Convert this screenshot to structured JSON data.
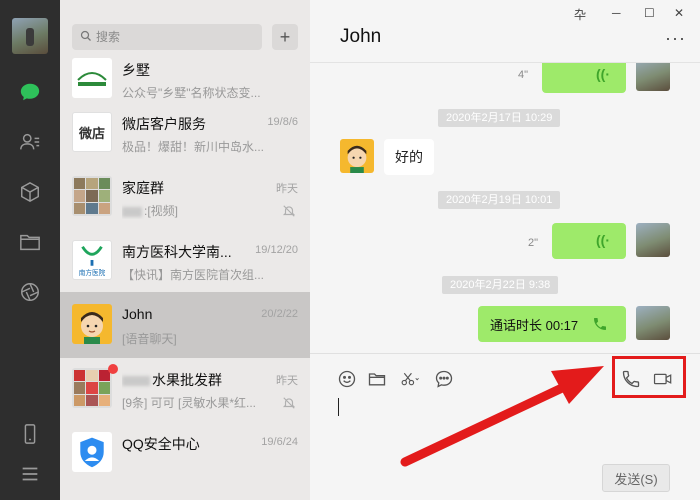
{
  "sidebar": {
    "icons": [
      "chat-icon",
      "contacts-icon",
      "favorites-icon",
      "folder-icon",
      "moments-icon",
      "phone-icon",
      "menu-icon"
    ]
  },
  "search": {
    "placeholder": "搜索",
    "add_label": "+"
  },
  "chats": [
    {
      "name": "乡墅",
      "time": "",
      "preview": "公众号\"乡墅\"名称状态变..."
    },
    {
      "name": "微店客户服务",
      "time": "19/8/6",
      "preview": "极品！爆甜！新川中岛水..."
    },
    {
      "name": "家庭群",
      "time": "昨天",
      "preview": ":[视频]",
      "muted": true
    },
    {
      "name": "南方医科大学南...",
      "time": "19/12/20",
      "preview": "【快讯】南方医院首次组..."
    },
    {
      "name": "John",
      "time": "20/2/22",
      "preview": "[语音聊天]"
    },
    {
      "name": "水果批发群",
      "time": "昨天",
      "preview": "[9条] 可可 [灵敏水果*红...",
      "muted": true
    },
    {
      "name": "QQ安全中心",
      "time": "19/6/24",
      "preview": ""
    }
  ],
  "chat_logos": {
    "weidian": "微店",
    "nanfang": "南方医院"
  },
  "conversation": {
    "title": "John",
    "window_controls": [
      "卆",
      "─",
      "☐",
      "✕"
    ],
    "more": "···",
    "messages": [
      {
        "type": "voice-out",
        "duration": "4\""
      },
      {
        "type": "timestamp",
        "text": "2020年2月17日 10:29"
      },
      {
        "type": "text-in",
        "text": "好的"
      },
      {
        "type": "timestamp",
        "text": "2020年2月19日 10:01"
      },
      {
        "type": "voice-out",
        "duration": "2\""
      },
      {
        "type": "timestamp",
        "text": "2020年2月22日 9:38"
      },
      {
        "type": "call-out",
        "text": "通话时长 00:17"
      }
    ]
  },
  "composer": {
    "tools": [
      "emoji-icon",
      "folder-icon",
      "scissors-icon",
      "chat-history-icon",
      "voice-call-icon",
      "video-call-icon"
    ],
    "send_label": "发送(S)"
  },
  "colors": {
    "accent_green": "#9eea6a",
    "highlight_red": "#e31b1b",
    "rail_bg": "#2e2e2e"
  }
}
